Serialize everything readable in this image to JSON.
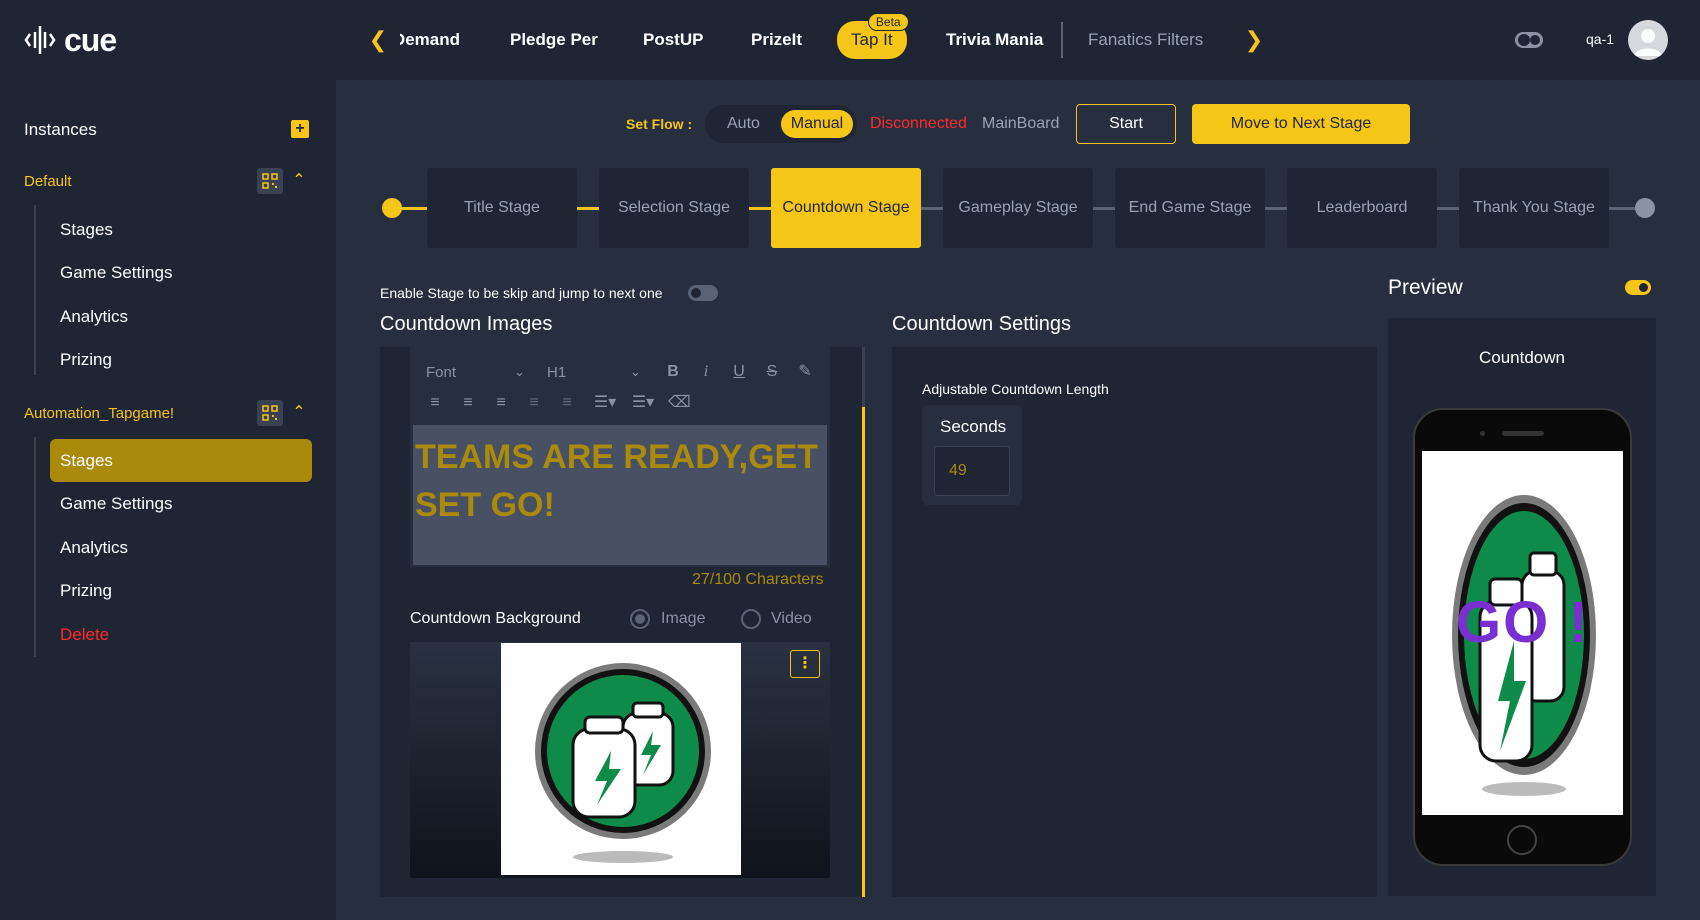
{
  "app": {
    "logo_text": "cue"
  },
  "topnav": {
    "tabs": [
      {
        "label": "Demand"
      },
      {
        "label": "Pledge Per"
      },
      {
        "label": "PostUP"
      },
      {
        "label": "PrizeIt"
      },
      {
        "label": "Tap It",
        "badge": "Beta"
      },
      {
        "label": "Trivia Mania"
      },
      {
        "label": "Fanatics Filters"
      }
    ],
    "user": "qa-1"
  },
  "sidebar": {
    "title": "Instances",
    "groups": [
      {
        "name": "Default",
        "items": [
          "Stages",
          "Game Settings",
          "Analytics",
          "Prizing"
        ]
      },
      {
        "name": "Automation_Tapgame!",
        "items": [
          "Stages",
          "Game Settings",
          "Analytics",
          "Prizing",
          "Delete"
        ]
      }
    ]
  },
  "flow": {
    "label": "Set Flow :",
    "auto": "Auto",
    "manual": "Manual",
    "status": "Disconnected",
    "board": "MainBoard",
    "start": "Start",
    "next": "Move to Next Stage"
  },
  "stages": [
    "Title Stage",
    "Selection Stage",
    "Countdown Stage",
    "Gameplay Stage",
    "End Game Stage",
    "Leaderboard",
    "Thank You Stage"
  ],
  "skip_label": "Enable Stage to be skip and jump to next one",
  "images": {
    "title": "Countdown Images",
    "font_select": "Font",
    "heading_select": "H1",
    "text": "TEAMS ARE READY,GET SET GO!",
    "char_count": "27/100 Characters",
    "bg_label": "Countdown Background",
    "bg_image": "Image",
    "bg_video": "Video"
  },
  "settings": {
    "title": "Countdown Settings",
    "adj_label": "Adjustable Countdown Length",
    "seconds_label": "Seconds",
    "seconds_value": "49"
  },
  "preview": {
    "title": "Preview",
    "caption": "Countdown",
    "overlay_text": "GO !"
  },
  "colors": {
    "accent": "#f5c518",
    "bg": "#272e3d",
    "panel": "#1f2533",
    "danger": "#ff2a2a"
  }
}
